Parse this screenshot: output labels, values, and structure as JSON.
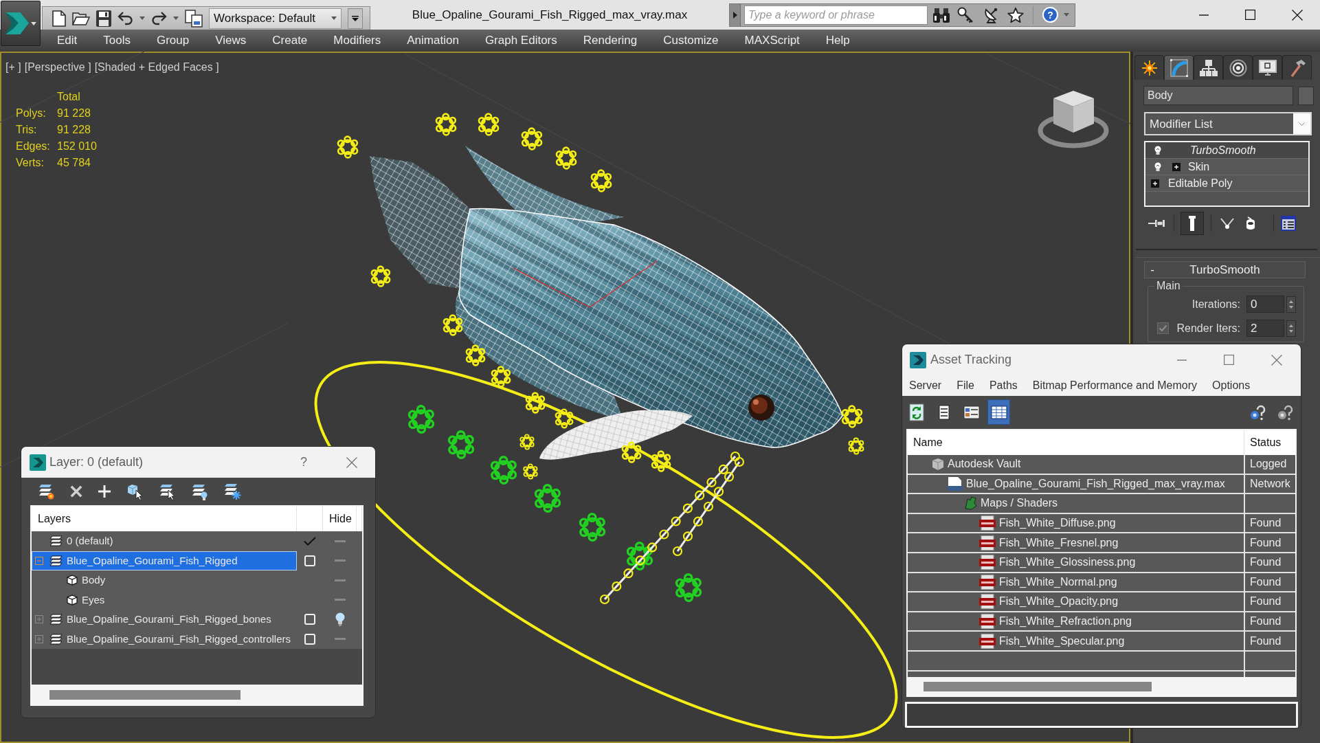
{
  "window": {
    "title": "Blue_Opaline_Gourami_Fish_Rigged_max_vray.max"
  },
  "quick_access": {
    "workspace": "Workspace: Default"
  },
  "search": {
    "placeholder": "Type a keyword or phrase",
    "help": "?"
  },
  "menu": [
    "Edit",
    "Tools",
    "Group",
    "Views",
    "Create",
    "Modifiers",
    "Animation",
    "Graph Editors",
    "Rendering",
    "Customize",
    "MAXScript",
    "Help"
  ],
  "viewport": {
    "labels": [
      "[+ ]",
      "[Perspective ]",
      "[Shaded + Edged Faces ]"
    ],
    "stats": {
      "header": "Total",
      "rows": [
        {
          "label": "Polys:",
          "value": "91 228"
        },
        {
          "label": "Tris:",
          "value": "91 228"
        },
        {
          "label": "Edges:",
          "value": "152 010"
        },
        {
          "label": "Verts:",
          "value": "45 784"
        }
      ]
    }
  },
  "command_panel": {
    "tabs": [
      {
        "selected": false
      },
      {
        "selected": true
      },
      {
        "selected": false
      },
      {
        "selected": false
      },
      {
        "selected": false
      },
      {
        "selected": false
      }
    ],
    "object_name": "Body",
    "modifier_list": "Modifier List",
    "stack": [
      {
        "label": "TurboSmooth",
        "light_bulb": true,
        "expandable": false,
        "off_in_viewport": true,
        "selected": true
      },
      {
        "label": "Skin",
        "light_bulb": true,
        "expandable": true,
        "off_in_viewport": false,
        "selected": false
      },
      {
        "label": "Editable Poly",
        "light_bulb": false,
        "expandable": true,
        "off_in_viewport": false,
        "selected": false
      }
    ],
    "stack_tools": [
      {
        "on": false
      },
      {
        "on": true
      },
      {
        "on": false
      },
      {
        "on": false
      },
      {
        "on": false
      }
    ],
    "rollout": {
      "sign": "-",
      "title": "TurboSmooth",
      "group": "Main",
      "fields": [
        {
          "kind": "spinner",
          "label": "Iterations:",
          "value": "0"
        },
        {
          "kind": "checked_spinner",
          "label": "Render Iters:",
          "value": "2",
          "checked": true,
          "disabled": true
        }
      ]
    }
  },
  "layer_dialog": {
    "title": "Layer: 0 (default)",
    "help": "?",
    "columns": [
      "Layers",
      "Hide"
    ],
    "rows": [
      {
        "kind": "layer",
        "name": "0 (default)",
        "current": true,
        "hidden": false,
        "selected": false
      },
      {
        "kind": "layer",
        "name": "Blue_Opaline_Gourami_Fish_Rigged",
        "expanded": true,
        "current": false,
        "hidden": false,
        "selected": true,
        "children": [
          {
            "kind": "object",
            "name": "Body",
            "hidden": false,
            "selected": false
          },
          {
            "kind": "object",
            "name": "Eyes",
            "hidden": false,
            "selected": false
          }
        ]
      },
      {
        "kind": "layer",
        "name": "Blue_Opaline_Gourami_Fish_Rigged_bones",
        "expanded": false,
        "current": false,
        "hidden": true,
        "selected": false
      },
      {
        "kind": "layer",
        "name": "Blue_Opaline_Gourami_Fish_Rigged_controllers",
        "expanded": false,
        "current": false,
        "hidden": false,
        "selected": false
      }
    ]
  },
  "asset_tracking": {
    "title": "Asset Tracking",
    "menu": [
      "Server",
      "File",
      "Paths",
      "Bitmap Performance and Memory",
      "Options"
    ],
    "tools": [
      {
        "selected": false
      },
      {
        "selected": false
      },
      {
        "selected": false
      },
      {
        "selected": true
      }
    ],
    "columns": [
      "Name",
      "Status"
    ],
    "rows": [
      {
        "kind": "vault",
        "name": "Autodesk Vault",
        "status": "Logged",
        "children": [
          {
            "kind": "max_file",
            "name": "Blue_Opaline_Gourami_Fish_Rigged_max_vray.max",
            "status": "Network",
            "children": [
              {
                "kind": "maps",
                "name": "Maps / Shaders",
                "children": [
                  {
                    "kind": "png",
                    "name": "Fish_White_Diffuse.png",
                    "status": "Found"
                  },
                  {
                    "kind": "png",
                    "name": "Fish_White_Fresnel.png",
                    "status": "Found"
                  },
                  {
                    "kind": "png",
                    "name": "Fish_White_Glossiness.png",
                    "status": "Found"
                  },
                  {
                    "kind": "png",
                    "name": "Fish_White_Normal.png",
                    "status": "Found"
                  },
                  {
                    "kind": "png",
                    "name": "Fish_White_Opacity.png",
                    "status": "Found"
                  },
                  {
                    "kind": "png",
                    "name": "Fish_White_Refraction.png",
                    "status": "Found"
                  },
                  {
                    "kind": "png",
                    "name": "Fish_White_Specular.png",
                    "status": "Found"
                  }
                ]
              }
            ]
          }
        ]
      }
    ]
  }
}
